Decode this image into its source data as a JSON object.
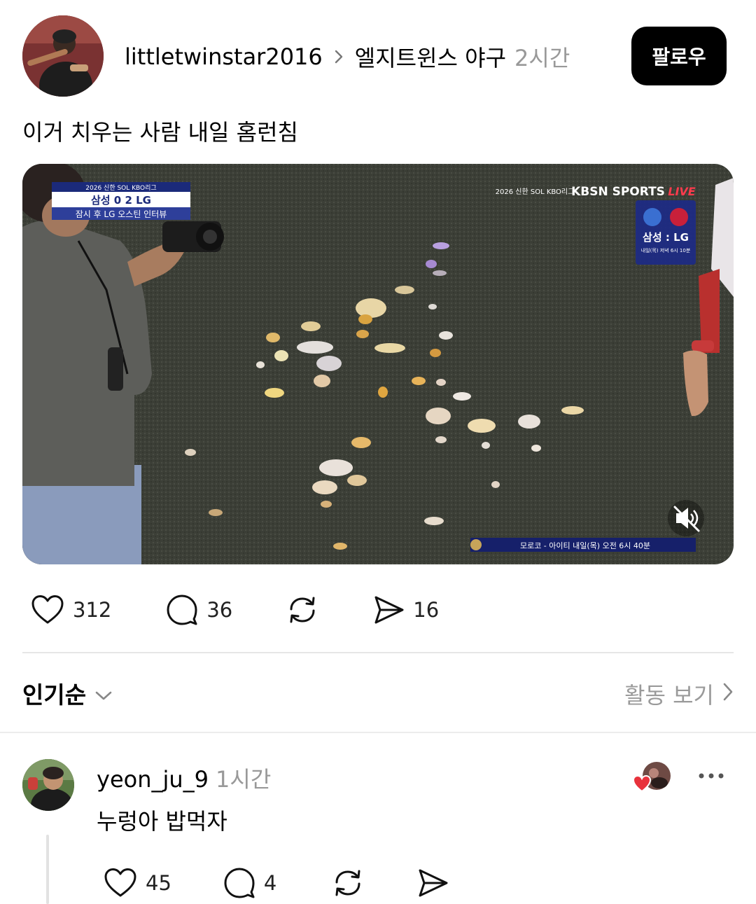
{
  "post": {
    "username": "littletwinstar2016",
    "community": "엘지트윈스 야구",
    "time": "2시간",
    "follow_label": "팔로우",
    "text": "이거 치우는 사람 내일 홈런침",
    "media": {
      "scoreboard_league": "2026 신한 SOL KBO리그",
      "scoreboard_score": "삼성 0 2 LG",
      "scoreboard_sub": "잠시 후 LG 오스틴 인터뷰",
      "broadcaster": "KBSN SPORTS",
      "live_label": "LIVE",
      "league_tag": "2026 신한 SOL KBO리그",
      "matchup": "삼성 : LG",
      "matchup_time": "내일(목) 저녁 6시 10분",
      "bottom_ticker": "모로코 - 아이티 내일(목) 오전 6시 40분",
      "mute_icon": "speaker-muted-icon"
    },
    "stats": {
      "likes": "312",
      "comments": "36",
      "shares": "16"
    }
  },
  "sort": {
    "label": "인기순",
    "activity_link": "활동 보기"
  },
  "comment": {
    "username": "yeon_ju_9",
    "time": "1시간",
    "text": "누렁아 밥먹자",
    "likes": "45",
    "replies": "4"
  },
  "colors": {
    "accent_heart": "#e8323c",
    "muted_text": "#999999",
    "follow_bg": "#000000"
  }
}
